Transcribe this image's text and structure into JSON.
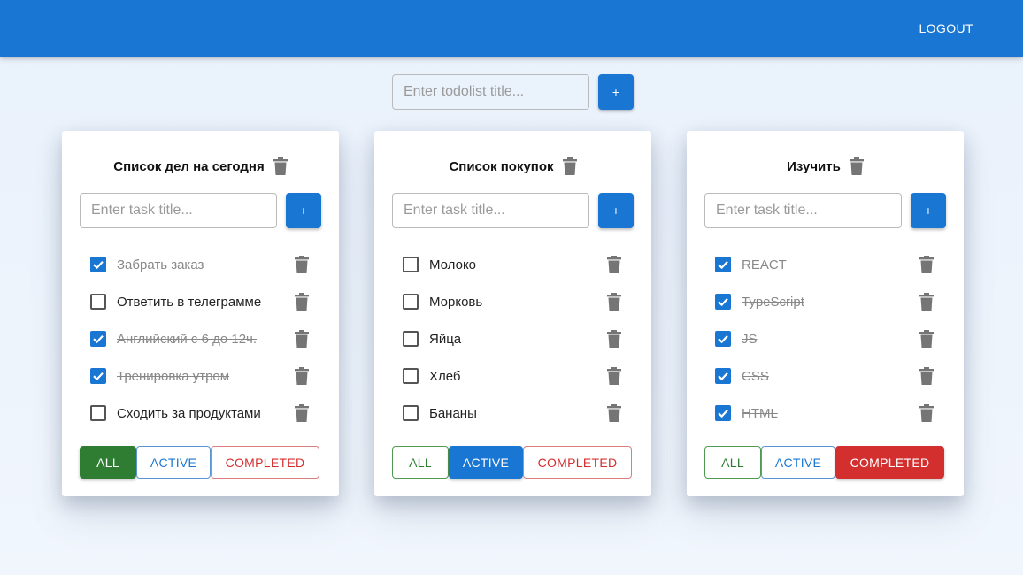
{
  "header": {
    "logout_label": "LOGOUT"
  },
  "add_todolist": {
    "placeholder": "Enter todolist title...",
    "button_label": "+"
  },
  "colors": {
    "primary": "#1976d2",
    "success": "#2e7d32",
    "error": "#d32f2f"
  },
  "todolists": [
    {
      "title": "Список дел на сегодня",
      "task_placeholder": "Enter task title...",
      "add_label": "+",
      "tasks": [
        {
          "label": "Забрать заказ",
          "done": true
        },
        {
          "label": "Ответить в телеграмме",
          "done": false
        },
        {
          "label": "Английский с 6 до 12ч.",
          "done": true
        },
        {
          "label": "Тренировка утром",
          "done": true
        },
        {
          "label": "Сходить за продуктами",
          "done": false
        }
      ],
      "filters": {
        "all": "ALL",
        "active": "ACTIVE",
        "completed": "COMPLETED",
        "selected": "all"
      }
    },
    {
      "title": "Список покупок",
      "task_placeholder": "Enter task title...",
      "add_label": "+",
      "tasks": [
        {
          "label": "Молоко",
          "done": false
        },
        {
          "label": "Морковь",
          "done": false
        },
        {
          "label": "Яйца",
          "done": false
        },
        {
          "label": "Хлеб",
          "done": false
        },
        {
          "label": "Бананы",
          "done": false
        }
      ],
      "filters": {
        "all": "ALL",
        "active": "ACTIVE",
        "completed": "COMPLETED",
        "selected": "active"
      }
    },
    {
      "title": "Изучить",
      "task_placeholder": "Enter task title...",
      "add_label": "+",
      "tasks": [
        {
          "label": "REACT",
          "done": true
        },
        {
          "label": "TypeScript",
          "done": true
        },
        {
          "label": "JS",
          "done": true
        },
        {
          "label": "CSS",
          "done": true
        },
        {
          "label": "HTML",
          "done": true
        }
      ],
      "filters": {
        "all": "ALL",
        "active": "ACTIVE",
        "completed": "COMPLETED",
        "selected": "completed"
      }
    }
  ]
}
